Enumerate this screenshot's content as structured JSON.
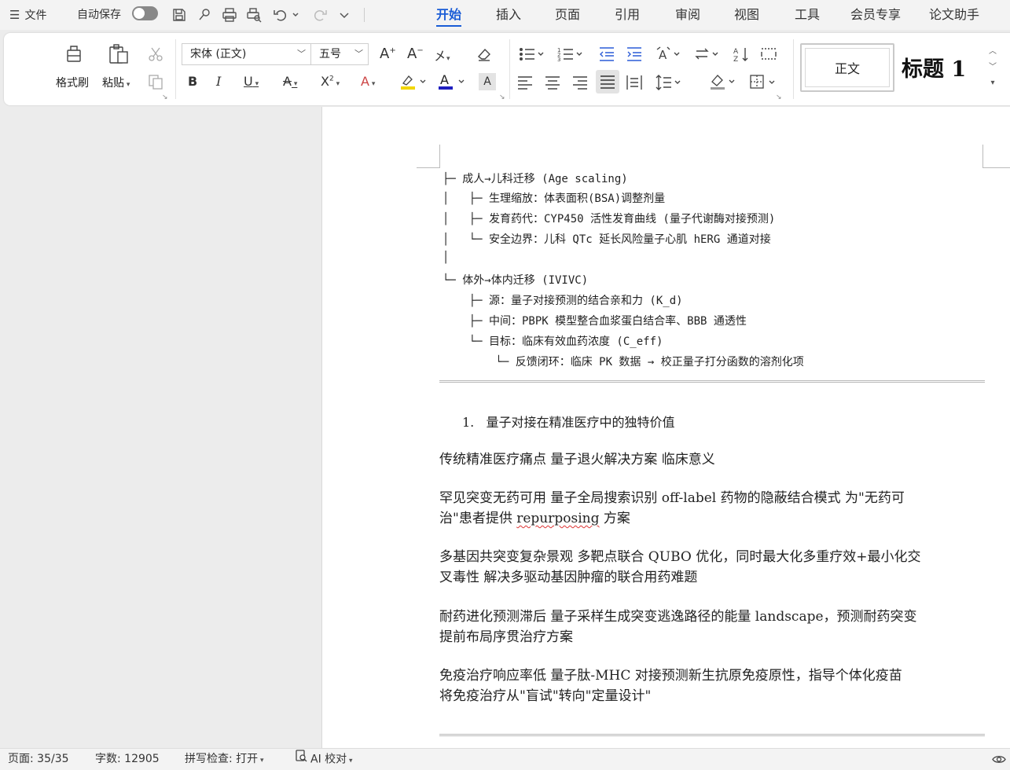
{
  "menubar": {
    "file_label": "文件",
    "autosave_label": "自动保存",
    "tabs": [
      "开始",
      "插入",
      "页面",
      "引用",
      "审阅",
      "视图",
      "工具",
      "会员专享",
      "论文助手"
    ],
    "active_tab": "开始"
  },
  "ribbon": {
    "format_painter": "格式刷",
    "paste": "粘贴",
    "font_name": "宋体 (正文)",
    "font_size": "五号",
    "style_normal": "正文",
    "style_heading1": "标题  1"
  },
  "document": {
    "tree": [
      "├─ 成人→儿科迁移 (Age scaling)",
      "│   ├─ 生理缩放：体表面积(BSA)调整剂量",
      "│   ├─ 发育药代：CYP450 活性发育曲线 (量子代谢酶对接预测)",
      "│   └─ 安全边界：儿科 QTc 延长风险量子心肌 hERG 通道对接",
      "│",
      "└─ 体外→体内迁移 (IVIVC)",
      "    ├─ 源：量子对接预测的结合亲和力 (K_d)",
      "    ├─ 中间：PBPK 模型整合血浆蛋白结合率、BBB 通透性",
      "    └─ 目标：临床有效血药浓度 (C_eff)",
      "        └─ 反馈闭环：临床 PK 数据 → 校正量子打分函数的溶剂化项"
    ],
    "heading_number": "1.",
    "heading_text": "量子对接在精准医疗中的独特价值",
    "table_header": "传统精准医疗痛点  量子退火解决方案  临床意义",
    "rows": [
      {
        "line1": "罕见突变无药可用  量子全局搜索识别 off-label 药物的隐蔽结合模式  为\"无药可",
        "line2a": "治\"患者提供  ",
        "line2_squiggle": "repurposing",
        "line2b": "  方案"
      },
      {
        "line1": "多基因共突变复杂景观  多靶点联合 QUBO 优化，同时最大化多重疗效+最小化交",
        "line2a": "叉毒性  解决多驱动基因肿瘤的联合用药难题",
        "line2_squiggle": "",
        "line2b": ""
      },
      {
        "line1": "耐药进化预测滞后  量子采样生成突变逃逸路径的能量  landscape，预测耐药突变",
        "line2a": "提前布局序贯治疗方案",
        "line2_squiggle": "",
        "line2b": ""
      },
      {
        "line1": "免疫治疗响应率低  量子肽-MHC 对接预测新生抗原免疫原性，指导个体化疫苗",
        "line2a": "将免疫治疗从\"盲试\"转向\"定量设计\"",
        "line2_squiggle": "",
        "line2b": ""
      }
    ]
  },
  "statusbar": {
    "page": "页面: 35/35",
    "words": "字数: 12905",
    "spellcheck": "拼写检查: 打开",
    "ai_check": "AI 校对"
  }
}
